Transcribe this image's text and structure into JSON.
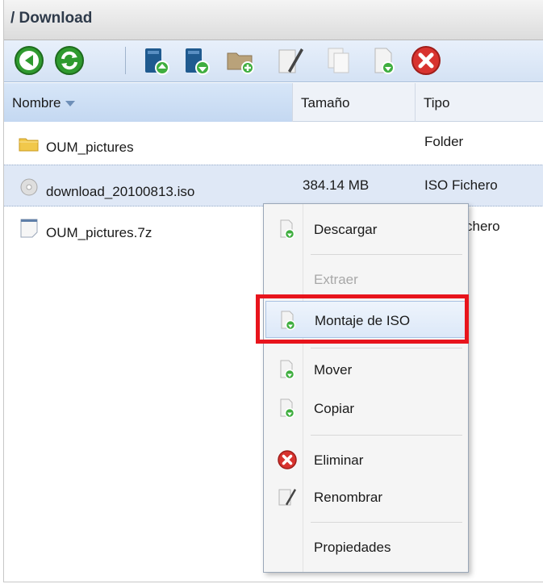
{
  "breadcrumb": "/ Download",
  "toolbar": {
    "buttons": [
      "back-icon",
      "refresh-icon",
      "upload-icon",
      "download-icon",
      "new-folder-icon",
      "rename-icon",
      "copy-icon",
      "file-download-icon",
      "delete-icon"
    ]
  },
  "columns": {
    "name": "Nombre",
    "size": "Tamaño",
    "type": "Tipo"
  },
  "files": [
    {
      "name": "OUM_pictures",
      "size": "",
      "type": "Folder",
      "icon": "folder-icon"
    },
    {
      "name": "download_20100813.iso",
      "size": "384.14 MB",
      "type": "ISO Fichero",
      "icon": "disc-icon",
      "selected": true
    },
    {
      "name": "OUM_pictures.7z",
      "size": "",
      "type": "chero",
      "icon": "file-icon"
    }
  ],
  "context_menu": {
    "items": [
      {
        "label": "Descargar",
        "icon": "download-icon",
        "enabled": true
      },
      {
        "label": "Extraer",
        "icon": "",
        "enabled": false
      },
      {
        "label": "Montaje de ISO",
        "icon": "download-icon",
        "enabled": true,
        "hovered": true
      },
      {
        "label": "Mover",
        "icon": "download-icon",
        "enabled": true
      },
      {
        "label": "Copiar",
        "icon": "download-icon",
        "enabled": true
      },
      {
        "label": "Eliminar",
        "icon": "delete-icon",
        "enabled": true
      },
      {
        "label": "Renombrar",
        "icon": "rename-icon",
        "enabled": true
      },
      {
        "label": "Propiedades",
        "icon": "",
        "enabled": true
      }
    ]
  },
  "colors": {
    "highlight": "#e8141c",
    "accent_green": "#2f9a2f",
    "accent_blue": "#1f5a8f"
  }
}
